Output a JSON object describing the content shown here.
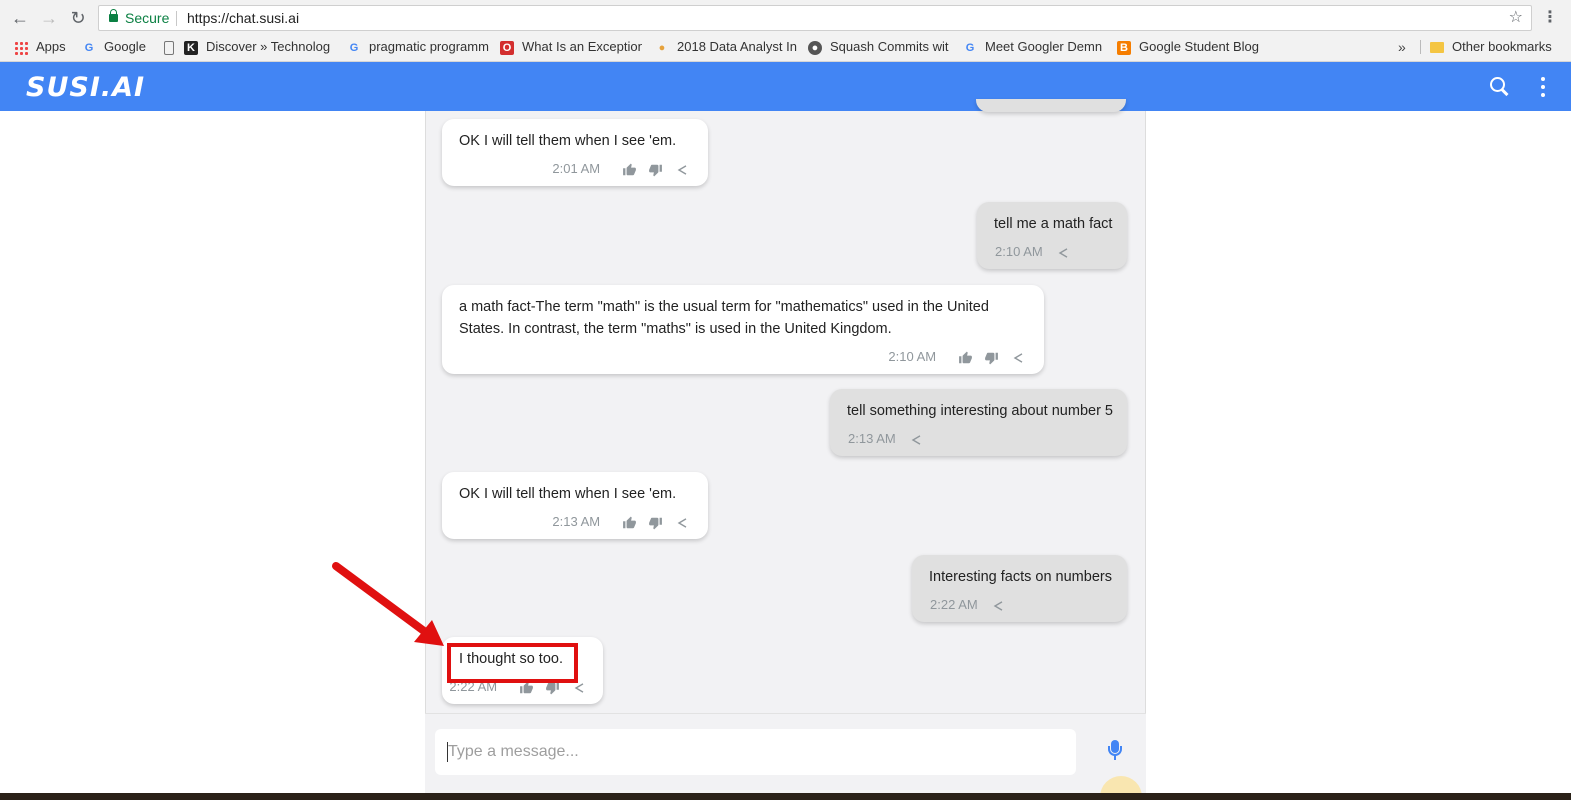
{
  "browser": {
    "secure_label": "Secure",
    "url": "https://chat.susi.ai",
    "bookmarks": [
      {
        "label": "Apps",
        "icon": "apps-grid-icon"
      },
      {
        "label": "Google",
        "icon": "google-g-icon"
      },
      {
        "label": "Discover » Technolog",
        "icon": "page-icon"
      },
      {
        "label": "pragmatic programm",
        "icon": "google-g-icon"
      },
      {
        "label": "What Is an Exception",
        "icon": "oracle-icon"
      },
      {
        "label": "2018 Data Analyst In",
        "icon": "bookmark-icon"
      },
      {
        "label": "Squash Commits wit",
        "icon": "github-icon"
      },
      {
        "label": "Meet Googler Demn",
        "icon": "google-g-icon"
      },
      {
        "label": "Google Student Blog",
        "icon": "blogger-icon"
      }
    ],
    "more_bookmarks": "»",
    "other_bookmarks": "Other bookmarks"
  },
  "app": {
    "logo": "SUSI.AI",
    "accent_color": "#4285f4"
  },
  "messages": [
    {
      "from": "susi",
      "text": "OK I will tell them when I see 'em.",
      "time": "2:01 AM"
    },
    {
      "from": "user",
      "text": "tell me a math fact",
      "time": "2:10 AM"
    },
    {
      "from": "susi",
      "text_line1": "a math fact-The term \"math\" is the usual term for \"mathematics\" used in the United",
      "text_line2": "States. In contrast, the term \"maths\" is used in the United Kingdom.",
      "time": "2:10 AM"
    },
    {
      "from": "user",
      "text": "tell something interesting about number 5",
      "time": "2:13 AM"
    },
    {
      "from": "susi",
      "text": "OK I will tell them when I see 'em.",
      "time": "2:13 AM"
    },
    {
      "from": "user",
      "text": "Interesting facts on numbers",
      "time": "2:22 AM"
    },
    {
      "from": "susi",
      "text": "I thought so too.",
      "time": "2:22 AM"
    }
  ],
  "composer": {
    "placeholder": "Type a message..."
  },
  "annotation": {
    "color": "#e01010"
  }
}
